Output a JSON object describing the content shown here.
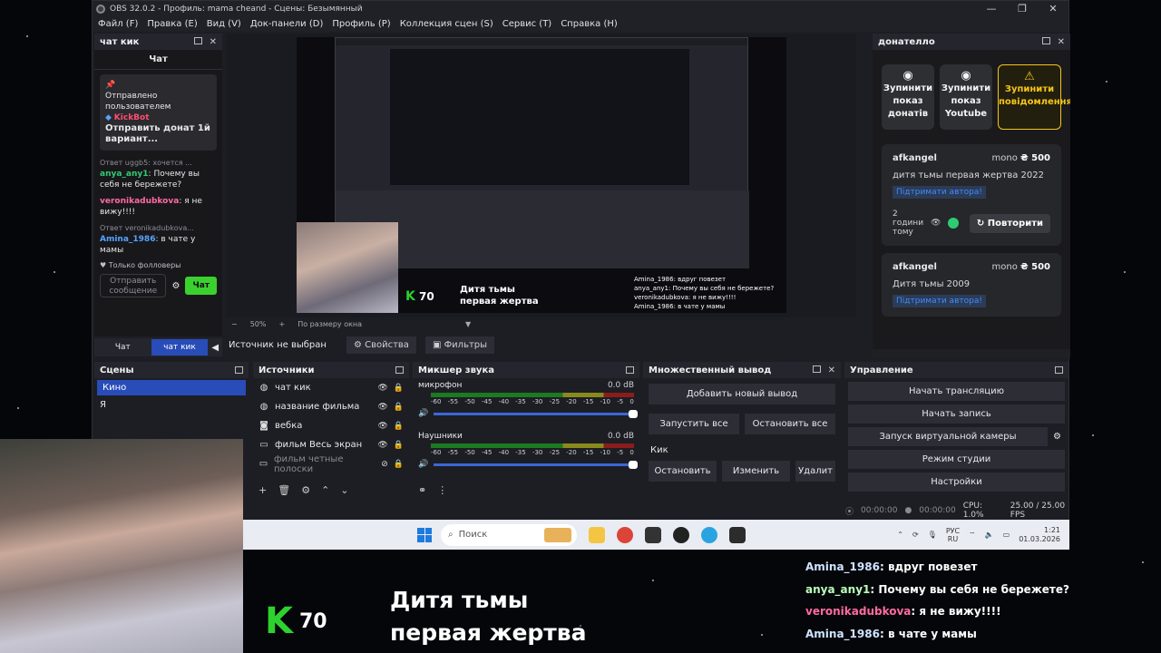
{
  "window": {
    "title": "OBS 32.0.2 - Профиль: mama cheand - Сцены: Безымянный",
    "controls": [
      "—",
      "❐",
      "✕"
    ]
  },
  "menu": [
    "Файл (F)",
    "Правка (E)",
    "Вид (V)",
    "Док-панели (D)",
    "Профиль (P)",
    "Коллекция сцен (S)",
    "Сервис (T)",
    "Справка (H)"
  ],
  "chat_dock": {
    "title": "чат кик",
    "header": "Чат",
    "pinned": {
      "label": "Отправлено пользователем",
      "user": "KickBot",
      "text": "Отправить донат 1й вариант..."
    },
    "messages": [
      {
        "reply": "Ответ uggb5: хочется ...",
        "name": "anya_any1",
        "text": "Почему вы себя не бережете?",
        "color": "#2ecc71"
      },
      {
        "reply": "",
        "name": "veronikadubkova",
        "text": "я не вижу!!!!",
        "color": "#ff6ba0"
      },
      {
        "reply": "Ответ veronikadubkova...",
        "name": "Amina_1986",
        "text": "в чате у мамы",
        "color": "#56a3ff"
      }
    ],
    "followers": "Только фолловеры",
    "input_placeholder": "Отправить сообщение",
    "send": "Чат",
    "tabs": [
      "Чат",
      "чат кик"
    ]
  },
  "preview": {
    "zoom": "50%",
    "scale_mode": "По размеру окна",
    "k70": "70",
    "film_title_line1": "Дитя тьмы",
    "film_title_line2": "первая жертва",
    "mini_chat": [
      "Amina_1986: вдруг повезет",
      "anya_any1: Почему вы себя не бережете?",
      "veronikadubkova: я не вижу!!!!",
      "Amina_1986: в чате у мамы"
    ]
  },
  "source_bar": {
    "status": "Источник не выбран",
    "properties": "Свойства",
    "filters": "Фильтры"
  },
  "donatello": {
    "title": "донателло",
    "buttons": [
      "Зупинити показ донатів",
      "Зупинити показ Youtube",
      "Зупинити повідомлення"
    ],
    "cards": [
      {
        "name": "afkangel",
        "currency": "mono",
        "amount": "₴ 500",
        "message": "дитя тьмы первая жертва 2022",
        "support": "Підтримати автора!",
        "time": "2 години тому",
        "repeat": "Повторити"
      },
      {
        "name": "afkangel",
        "currency": "mono",
        "amount": "₴ 500",
        "message": "Дитя тьмы 2009",
        "support": "Підтримати автора!"
      }
    ]
  },
  "scenes": {
    "title": "Сцены",
    "items": [
      "Кино",
      "Я"
    ]
  },
  "sources": {
    "title": "Источники",
    "items": [
      "чат кик",
      "название фильма",
      "вебка",
      "фильм Весь экран",
      "фильм четные полоски"
    ]
  },
  "mixer": {
    "title": "Микшер звука",
    "channels": [
      {
        "name": "микрофон",
        "db": "0.0 dB"
      },
      {
        "name": "Наушники",
        "db": "0.0 dB"
      }
    ],
    "ticks": [
      "-60",
      "-55",
      "-50",
      "-45",
      "-40",
      "-35",
      "-30",
      "-25",
      "-20",
      "-15",
      "-10",
      "-5",
      "0"
    ]
  },
  "multi_output": {
    "title": "Множественный вывод",
    "add": "Добавить новый вывод",
    "start_all": "Запустить все",
    "stop_all": "Остановить все",
    "target": "Кик",
    "stop": "Остановить",
    "edit": "Изменить",
    "delete": "Удалит"
  },
  "controls": {
    "title": "Управление",
    "buttons": [
      "Начать трансляцию",
      "Начать запись",
      "Запуск виртуальной камеры",
      "Режим студии",
      "Настройки"
    ]
  },
  "status": {
    "stream_time": "00:00:00",
    "rec_time": "00:00:00",
    "cpu": "CPU: 1.0%",
    "fps": "25.00 / 25.00 FPS"
  },
  "taskbar": {
    "search": "Поиск",
    "lang_1": "РУС",
    "lang_2": "RU",
    "time": "1:21",
    "date": "01.03.2026"
  },
  "overlay": {
    "k_number": "70",
    "title_line1": "Дитя тьмы",
    "title_line2": "первая жертва",
    "chat": [
      {
        "name": "Amina_1986",
        "text": "вдруг повезет",
        "color": "#cfe3ff"
      },
      {
        "name": "anya_any1",
        "text": "Почему вы себя не бережете?",
        "color": "#b9ffb9"
      },
      {
        "name": "veronikadubkova",
        "text": "я не вижу!!!!",
        "color": "#ff6ba0"
      },
      {
        "name": "Amina_1986",
        "text": "в чате у мамы",
        "color": "#cfe3ff"
      }
    ]
  },
  "colors": {
    "accent": "#284cb8",
    "kick_green": "#2ed22e",
    "warn": "#f5c518"
  }
}
